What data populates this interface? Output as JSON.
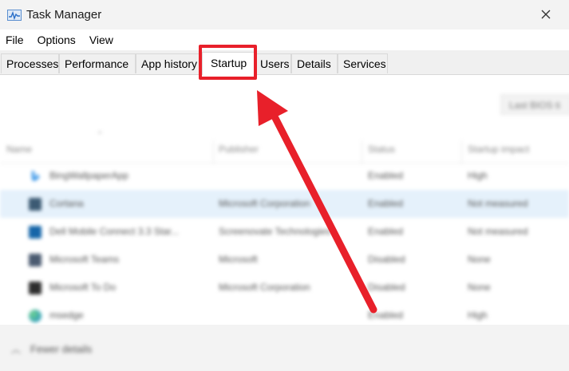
{
  "window": {
    "title": "Task Manager"
  },
  "menu": [
    "File",
    "Options",
    "View"
  ],
  "tabs": [
    "Processes",
    "Performance",
    "App history",
    "Startup",
    "Users",
    "Details",
    "Services"
  ],
  "active_tab": "Startup",
  "toolbar": {
    "last_bios_label": "Last BIOS ti"
  },
  "columns": [
    "Name",
    "Publisher",
    "Status",
    "Startup impact"
  ],
  "rows": [
    {
      "name": "BingWallpaperApp",
      "publisher": "",
      "status": "Enabled",
      "impact": "High",
      "icon": "bing-icon",
      "icon_color": "#1e88e5"
    },
    {
      "name": "Cortana",
      "publisher": "Microsoft Corporation",
      "status": "Enabled",
      "impact": "Not measured",
      "icon": "cortana-icon",
      "icon_color": "#3c5a73"
    },
    {
      "name": "Dell Mobile Connect 3.3 Star...",
      "publisher": "Screenovate Technologies",
      "status": "Enabled",
      "impact": "Not measured",
      "icon": "dell-mobile-connect-icon",
      "icon_color": "#1565a8"
    },
    {
      "name": "Microsoft Teams",
      "publisher": "Microsoft",
      "status": "Disabled",
      "impact": "None",
      "icon": "teams-icon",
      "icon_color": "#4a5a70"
    },
    {
      "name": "Microsoft To Do",
      "publisher": "Microsoft Corporation",
      "status": "Disabled",
      "impact": "None",
      "icon": "todo-icon",
      "icon_color": "#2d2d2d"
    },
    {
      "name": "msedge",
      "publisher": "",
      "status": "Enabled",
      "impact": "High",
      "icon": "edge-icon",
      "icon_color": "#1aa06d"
    }
  ],
  "footer": {
    "fewer_details": "Fewer details"
  },
  "colors": {
    "highlight": "#e8202a",
    "selected_row": "#e5f1fb",
    "title_bar": "#f3f3f3"
  }
}
